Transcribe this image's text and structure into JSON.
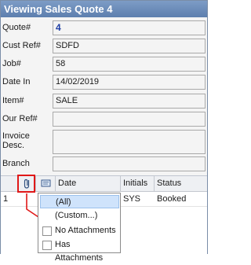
{
  "window": {
    "title": "Viewing Sales Quote 4"
  },
  "form": {
    "quote_label": "Quote#",
    "quote_value": "4",
    "cust_ref_label": "Cust Ref#",
    "cust_ref_value": "SDFD",
    "job_label": "Job#",
    "job_value": "58",
    "date_in_label": "Date In",
    "date_in_value": "14/02/2019",
    "item_label": "Item#",
    "item_value": "SALE",
    "our_ref_label": "Our Ref#",
    "our_ref_value": "",
    "invoice_desc_label_1": "Invoice",
    "invoice_desc_label_2": "Desc.",
    "invoice_desc_value": "",
    "branch_label": "Branch",
    "branch_value": ""
  },
  "grid": {
    "columns": [
      "",
      "",
      "Date",
      "Initials",
      "Status"
    ],
    "rows": [
      {
        "num": "1",
        "initials": "SYS",
        "status": "Booked"
      }
    ]
  },
  "attachment_filter": {
    "options": [
      {
        "label": "(All)",
        "selected": true,
        "checkbox": false
      },
      {
        "label": "(Custom...)",
        "selected": false,
        "checkbox": false
      },
      {
        "label": "No Attachments",
        "selected": false,
        "checkbox": true
      },
      {
        "label": "Has Attachments",
        "selected": false,
        "checkbox": true
      }
    ]
  },
  "colors": {
    "title_bar": "#6a8bb9",
    "highlight": "#e01818",
    "value_blue": "#1f3fa6",
    "selected_item": "#cfe3fb"
  },
  "icons": [
    "paperclip-icon",
    "note-icon",
    "arrow-icon"
  ]
}
